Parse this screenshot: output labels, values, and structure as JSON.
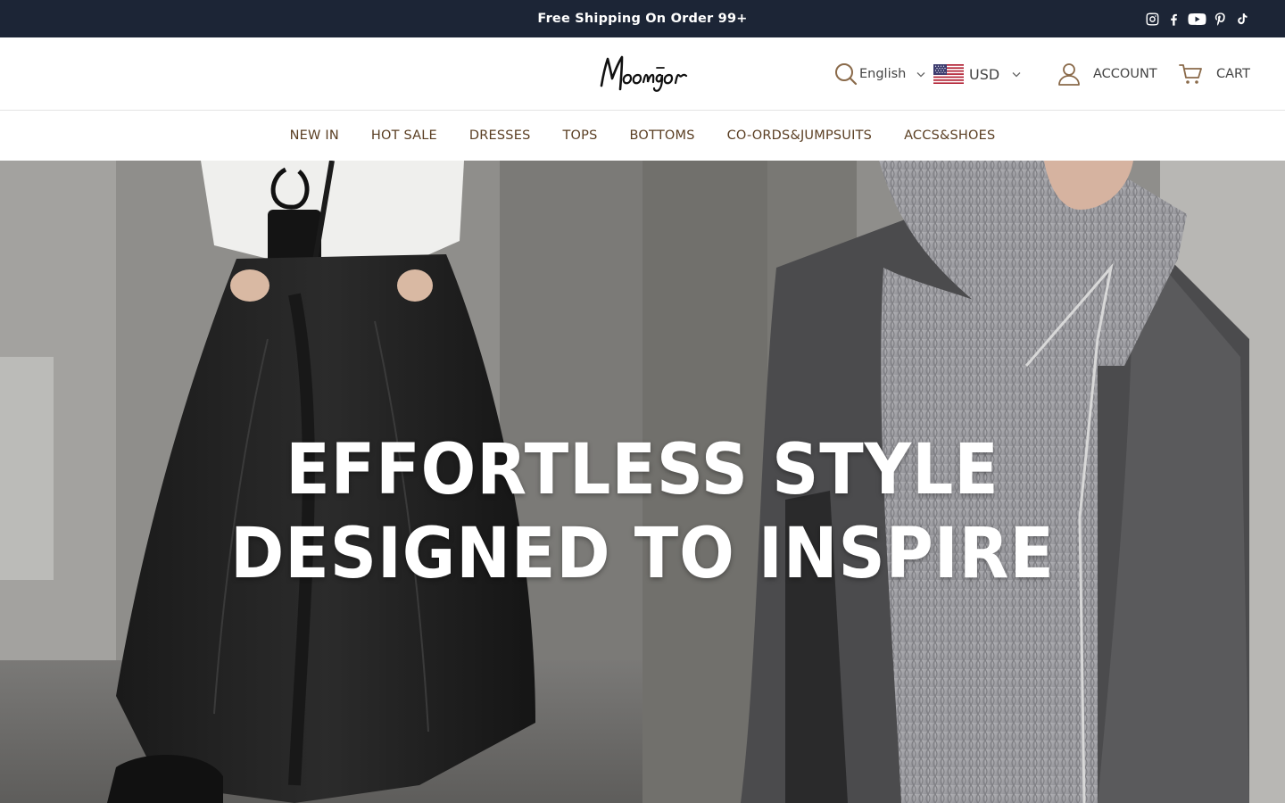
{
  "announcement": {
    "message": "Free Shipping On Order 99+"
  },
  "social_links": [
    {
      "name": "instagram-icon"
    },
    {
      "name": "facebook-icon"
    },
    {
      "name": "youtube-icon"
    },
    {
      "name": "pinterest-icon"
    },
    {
      "name": "tiktok-icon"
    }
  ],
  "header": {
    "logo_text": "Moongor",
    "language": "English",
    "currency": "USD",
    "account_label": "ACCOUNT",
    "cart_label": "CART"
  },
  "nav": {
    "items": [
      {
        "label": "NEW IN"
      },
      {
        "label": "HOT SALE"
      },
      {
        "label": "DRESSES"
      },
      {
        "label": "TOPS"
      },
      {
        "label": "BOTTOMS"
      },
      {
        "label": "CO-ORDS&JUMPSUITS"
      },
      {
        "label": "ACCS&SHOES"
      }
    ]
  },
  "hero": {
    "line1": "EFFORTLESS STYLE",
    "line2": "DESIGNED TO INSPIRE"
  },
  "colors": {
    "announcement_bg": "#1c2536",
    "nav_text": "#5a3e22",
    "icon_stroke": "#8a6a4a"
  }
}
